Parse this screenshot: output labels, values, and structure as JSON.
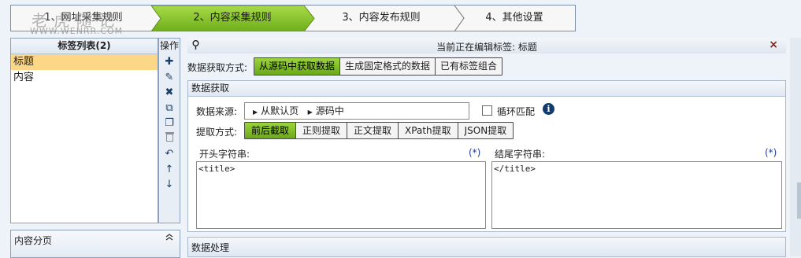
{
  "wizard": {
    "steps": [
      "1、网址采集规则",
      "2、内容采集规则",
      "3、内容发布规则",
      "4、其他设置"
    ],
    "active_index": 1
  },
  "watermark": {
    "line1": "老 虎 随 记",
    "line2": "WWW.WENRR.COM"
  },
  "tag_list": {
    "title": "标签列表(2)",
    "items": [
      "标题",
      "内容"
    ],
    "selected": 0
  },
  "operations": {
    "title": "操作",
    "icons": [
      "plus-icon",
      "pencil-icon",
      "delete-icon",
      "copy-icon",
      "paste-icon",
      "trash-icon",
      "undo-icon",
      "up-arrow-icon",
      "down-arrow-icon"
    ],
    "glyphs": [
      "✚",
      "✎",
      "✖",
      "⧉",
      "❐",
      "🗑",
      "↶",
      "↑",
      "↓"
    ]
  },
  "paging": {
    "title": "内容分页",
    "toggle": "≈"
  },
  "editor": {
    "title": "当前正在编辑标签: 标题",
    "close": "×",
    "method_label": "数据获取方式:",
    "methods": [
      "从源码中获取数据",
      "生成固定格式的数据",
      "已有标签组合"
    ],
    "method_selected": 0
  },
  "fetch": {
    "title": "数据获取",
    "source_label": "数据来源:",
    "source_path": [
      "从默认页",
      "源码中"
    ],
    "loop_label": "循环匹配",
    "loop_checked": false,
    "info": "i",
    "extract_label": "提取方式:",
    "extract_methods": [
      "前后截取",
      "正则提取",
      "正文提取",
      "XPath提取",
      "JSON提取"
    ],
    "extract_selected": 0,
    "start_label": "开头字符串:",
    "start_star": "(*)",
    "start_value": "<title>",
    "end_label": "结尾字符串:",
    "end_star": "(*)",
    "end_value": "</title>"
  },
  "process": {
    "title": "数据处理"
  },
  "colors": {
    "accent_green": "#7fbf2a",
    "selected_tag": "#fbd787",
    "icon_blue": "#1d3e6a"
  }
}
